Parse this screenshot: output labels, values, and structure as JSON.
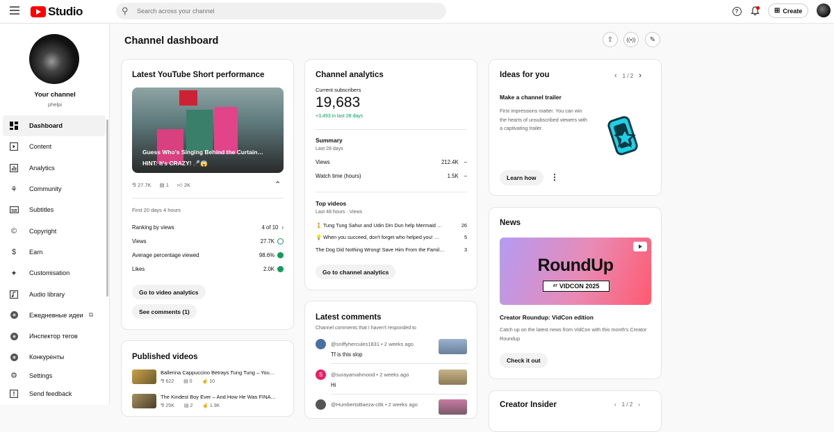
{
  "topbar": {
    "logo_text": "Studio",
    "search_placeholder": "Search across your channel",
    "create_label": "Create"
  },
  "sidebar": {
    "channel_label": "Your channel",
    "handle": "phelpi",
    "items": [
      {
        "label": "Dashboard",
        "icon": "dashboard-icon",
        "active": true
      },
      {
        "label": "Content",
        "icon": "content-icon"
      },
      {
        "label": "Analytics",
        "icon": "analytics-icon"
      },
      {
        "label": "Community",
        "icon": "community-icon"
      },
      {
        "label": "Subtitles",
        "icon": "subtitles-icon"
      },
      {
        "label": "Copyright",
        "icon": "copyright-icon"
      },
      {
        "label": "Earn",
        "icon": "earn-icon"
      },
      {
        "label": "Customisation",
        "icon": "customisation-icon"
      },
      {
        "label": "Audio library",
        "icon": "audio-library-icon"
      },
      {
        "label": "Ежедневные идеи",
        "icon": "extension-icon",
        "external": true
      },
      {
        "label": "Инспектор тегов",
        "icon": "extension-icon"
      },
      {
        "label": "Конкуренты",
        "icon": "extension-icon"
      },
      {
        "label": "Settings",
        "icon": "settings-icon"
      },
      {
        "label": "Send feedback",
        "icon": "feedback-icon"
      }
    ]
  },
  "page": {
    "title": "Channel dashboard"
  },
  "short_card": {
    "title": "Latest YouTube Short performance",
    "thumb_line1": "Guess Who's Singing Behind the Curtain…",
    "thumb_line2": "HINT: It's CRAZY! 🎤😱",
    "views": "27.7K",
    "comments": "1",
    "likes": "2K",
    "period": "First 20 days 4 hours",
    "rows": [
      {
        "label": "Ranking by views",
        "value": "4 of 10"
      },
      {
        "label": "Views",
        "value": "27.7K"
      },
      {
        "label": "Average percentage viewed",
        "value": "98.6%"
      },
      {
        "label": "Likes",
        "value": "2.0K"
      }
    ],
    "btn_analytics": "Go to video analytics",
    "btn_comments": "See comments (1)"
  },
  "published": {
    "title": "Published videos",
    "videos": [
      {
        "title": "Ballerina Cappuccino Betrays Tung Tung – You…",
        "views": "622",
        "comments": "0",
        "likes": "10"
      },
      {
        "title": "The Kindest Boy Ever – And How He Was FINA…",
        "views": "25K",
        "comments": "2",
        "likes": "1.9K"
      }
    ]
  },
  "analytics": {
    "title": "Channel analytics",
    "subs_label": "Current subscribers",
    "subs_value": "19,683",
    "subs_delta": "+3,493 in last 28 days",
    "summary_title": "Summary",
    "summary_period": "Last 28 days",
    "summary_rows": [
      {
        "label": "Views",
        "value": "212.4K",
        "trend": "–"
      },
      {
        "label": "Watch time (hours)",
        "value": "1.5K",
        "trend": "–"
      }
    ],
    "top_title": "Top videos",
    "top_period": "Last 48 hours · Views",
    "top_videos": [
      {
        "title": "Tung Tung Sahur and Udin Din Dun help Mermaid …",
        "views": "26",
        "emoji": "🧜"
      },
      {
        "title": "When you succeed, don't forget who helped you! …",
        "views": "5",
        "emoji": "💡"
      },
      {
        "title": "The Dog Did Nothing Wrong! Save Him From the Famil…",
        "views": "3",
        "emoji": ""
      }
    ],
    "btn": "Go to channel analytics"
  },
  "comments": {
    "title": "Latest comments",
    "subtitle": "Channel comments that I haven't responded to",
    "items": [
      {
        "author": "@sniffyhercules1831 • 2 weeks ago",
        "text": "Tf is this slop",
        "avatar_color": "#4a6fa5",
        "initial": ""
      },
      {
        "author": "@surayamahmood • 2 weeks ago",
        "text": "Hi",
        "avatar_color": "#e91e63",
        "initial": "S"
      },
      {
        "author": "@HumbertoBaeza-c8k • 2 weeks ago",
        "text": "",
        "avatar_color": "#555",
        "initial": ""
      }
    ]
  },
  "ideas": {
    "title": "Ideas for you",
    "pager": "1 / 2",
    "subtitle": "Make a channel trailer",
    "body": "First impressions matter. You can win the hearts of unsubscribed viewers with a captivating trailer.",
    "btn": "Learn how"
  },
  "news": {
    "title": "News",
    "banner_title": "RoundUp",
    "banner_at": "AT",
    "banner_event": "VIDCON 2025",
    "headline": "Creator Roundup: VidCon edition",
    "body": "Catch up on the latest news from VidCon with this month's Creator Roundup",
    "btn": "Check it out"
  },
  "insider": {
    "title": "Creator Insider",
    "pager": "1 / 2"
  },
  "colors": {
    "brand_red": "#ff0000",
    "positive_green": "#0f9d58",
    "accent_cyan": "#1fd1e8"
  }
}
